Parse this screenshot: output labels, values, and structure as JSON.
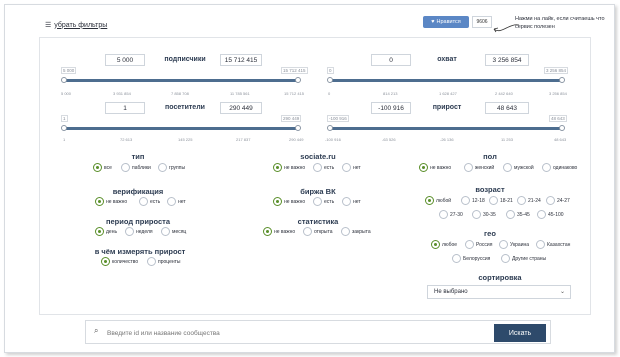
{
  "top": {
    "filters_label": "убрать фильтры",
    "like_label": "Нравится",
    "like_count": "9606",
    "hint": "Нажми на лайк, если считаешь что сервис полезен"
  },
  "ranges": {
    "subscribers": {
      "label": "подписчики",
      "min": "5 000",
      "max": "15 712 415",
      "min_flag": "5 000",
      "max_flag": "15 712 415",
      "ticks": [
        "5 000",
        "3 931 854",
        "7 858 708",
        "11 785 561",
        "15 712 415"
      ]
    },
    "reach": {
      "label": "охват",
      "min": "0",
      "max": "3 256 854",
      "min_flag": "0",
      "max_flag": "3 256 854",
      "ticks": [
        "0",
        "814 213",
        "1 628 427",
        "2 442 640",
        "3 256 854"
      ]
    },
    "visitors": {
      "label": "посетители",
      "min": "1",
      "max": "290 449",
      "min_flag": "1",
      "max_flag": "290 449",
      "ticks": [
        "1",
        "72 613",
        "145 225",
        "217 837",
        "290 449"
      ]
    },
    "growth": {
      "label": "прирост",
      "min": "-100 916",
      "max": "48 643",
      "min_flag": "-100 916",
      "max_flag": "48 643",
      "ticks": [
        "-100 916",
        "-63 526",
        "-26 136",
        "11 253",
        "48 643"
      ]
    }
  },
  "groups": {
    "type": {
      "title": "тип",
      "options": [
        "все",
        "паблики",
        "группы"
      ],
      "selected": 0
    },
    "verification": {
      "title": "верификация",
      "options": [
        "не важно",
        "есть",
        "нет"
      ],
      "selected": 0
    },
    "growth_period": {
      "title": "период прироста",
      "options": [
        "день",
        "неделя",
        "месяц"
      ],
      "selected": 0
    },
    "measure": {
      "title": "в чём измерять прирост",
      "options": [
        "количество",
        "проценты"
      ],
      "selected": 0
    },
    "sociate": {
      "title": "sociate.ru",
      "options": [
        "не важно",
        "есть",
        "нет"
      ],
      "selected": 0
    },
    "vk_exchange": {
      "title": "биржа ВК",
      "options": [
        "не важно",
        "есть",
        "нет"
      ],
      "selected": 0
    },
    "stats": {
      "title": "статистика",
      "options": [
        "не важно",
        "открыта",
        "закрыта"
      ],
      "selected": 0
    },
    "gender": {
      "title": "пол",
      "options": [
        "не важно",
        "женский",
        "мужской",
        "одинаково"
      ],
      "selected": 0
    },
    "age": {
      "title": "возраст",
      "options": [
        "любой",
        "12-18",
        "18-21",
        "21-24",
        "24-27",
        "27-30",
        "30-35",
        "35-45",
        "45-100"
      ],
      "selected": 0
    },
    "geo": {
      "title": "гео",
      "options": [
        "любое",
        "Россия",
        "Украина",
        "Казахстан",
        "Белоруссия",
        "Другие страны"
      ],
      "selected": 0
    },
    "sort": {
      "title": "сортировка",
      "value": "Не выбрано"
    }
  },
  "search": {
    "placeholder": "Введите id или название сообщества",
    "button": "Искать"
  },
  "colors": {
    "accent": "#5a8f2a",
    "button": "#2e4a6b",
    "like": "#5b87c5"
  }
}
